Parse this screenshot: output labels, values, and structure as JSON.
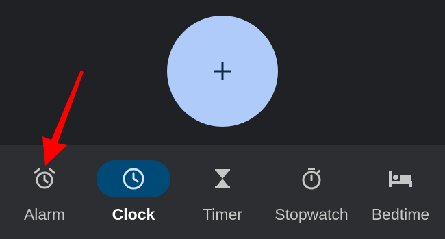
{
  "fab": {
    "icon": "plus-icon",
    "color": "#aecbfa"
  },
  "nav": {
    "active_color": "#004a77",
    "items": [
      {
        "label": "Alarm",
        "icon": "alarm-icon",
        "active": false
      },
      {
        "label": "Clock",
        "icon": "clock-icon",
        "active": true
      },
      {
        "label": "Timer",
        "icon": "hourglass-icon",
        "active": false
      },
      {
        "label": "Stopwatch",
        "icon": "stopwatch-icon",
        "active": false
      },
      {
        "label": "Bedtime",
        "icon": "bed-icon",
        "active": false
      }
    ]
  },
  "annotation": {
    "icon": "red-arrow-icon",
    "color": "#ff0000"
  }
}
